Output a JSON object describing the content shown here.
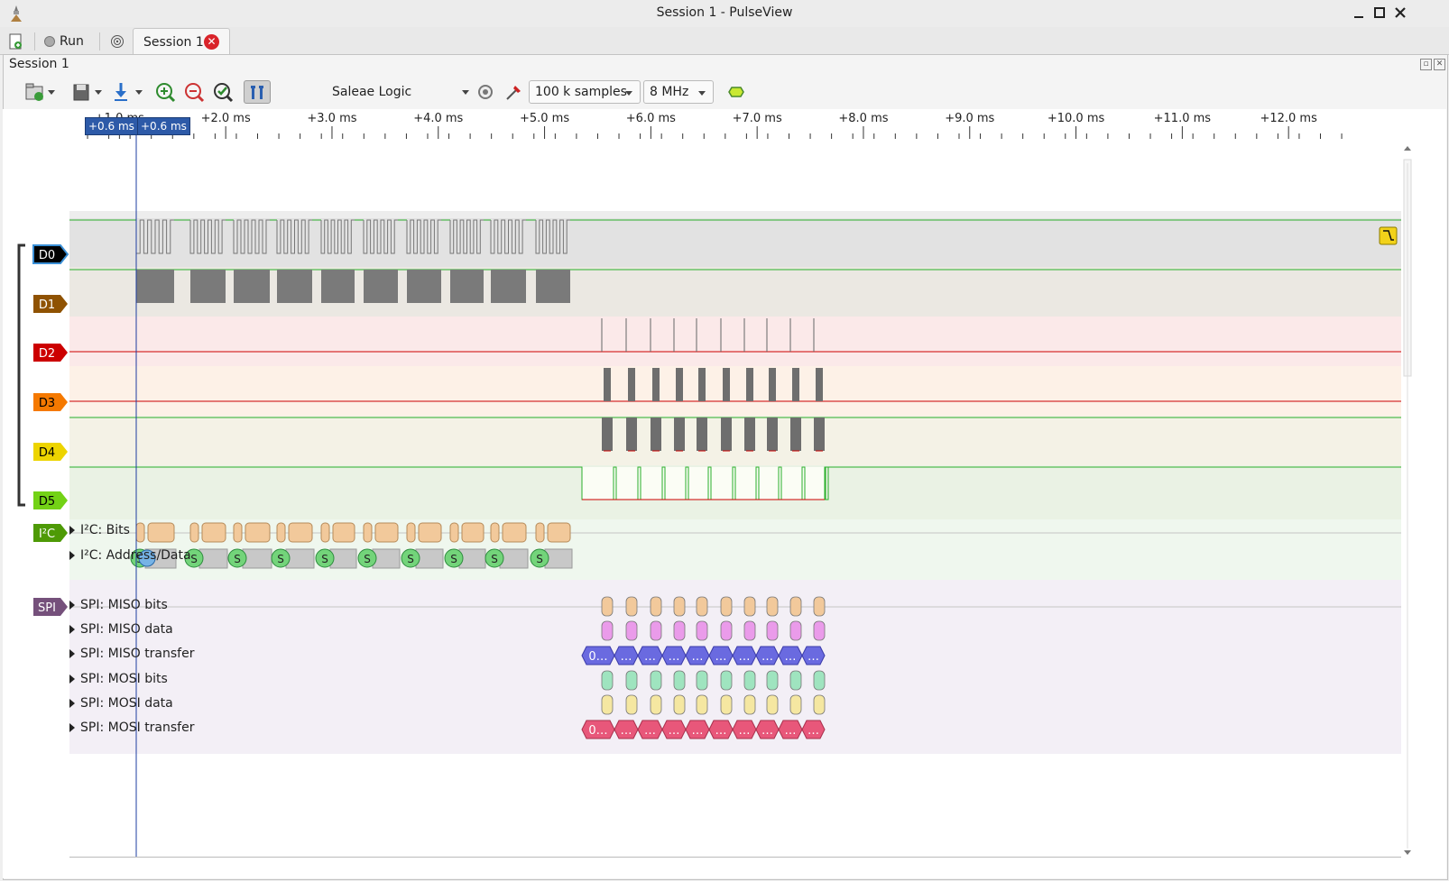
{
  "window": {
    "title": "Session 1 - PulseView"
  },
  "tabbar": {
    "run_label": "Run",
    "session_tab_label": "Session 1"
  },
  "panel": {
    "title": "Session 1"
  },
  "toolbar": {
    "device": "Saleae Logic",
    "samples": "100 k samples",
    "samplerate": "8 MHz"
  },
  "ruler": {
    "cursor_left": "+0.6 ms",
    "cursor_right": "+0.6 ms",
    "ticks": [
      "+1.0 ms",
      "+2.0 ms",
      "+3.0 ms",
      "+4.0 ms",
      "+5.0 ms",
      "+6.0 ms",
      "+7.0 ms",
      "+8.0 ms",
      "+9.0 ms",
      "+10.0 ms",
      "+11.0 ms",
      "+12.0 ms"
    ]
  },
  "channels": [
    {
      "name": "D0",
      "color": "#000000",
      "text_color": "#ffffff",
      "selected": true
    },
    {
      "name": "D1",
      "color": "#8f5202",
      "text_color": "#ffffff"
    },
    {
      "name": "D2",
      "color": "#cc0000",
      "text_color": "#ffffff"
    },
    {
      "name": "D3",
      "color": "#f57900",
      "text_color": "#000000"
    },
    {
      "name": "D4",
      "color": "#edd400",
      "text_color": "#000000"
    },
    {
      "name": "D5",
      "color": "#73d216",
      "text_color": "#000000"
    }
  ],
  "decoders": {
    "i2c": {
      "tag": "I²C",
      "color": "#4e9a06",
      "rows": [
        "I²C: Bits",
        "I²C: Address/Data"
      ]
    },
    "spi": {
      "tag": "SPI",
      "color": "#75507b",
      "rows": [
        "SPI: MISO bits",
        "SPI: MISO data",
        "SPI: MISO transfer",
        "SPI: MOSI bits",
        "SPI: MOSI data",
        "SPI: MOSI transfer"
      ]
    }
  },
  "annotations": {
    "i2c_start": "S",
    "spi_transfer_first": "0…",
    "spi_transfer_more": "…"
  },
  "colors": {
    "signal_high": "#2aaf2a",
    "signal_low": "#cc0000",
    "cursor": "#1d3ca0",
    "i2c_bits": "#f2c99b",
    "i2c_start": "#73d47a",
    "miso_bits": "#f2c99b",
    "miso_data": "#ea9bea",
    "miso_transfer": "#6a6ae0",
    "mosi_bits": "#9fe4bf",
    "mosi_data": "#f5e7a1",
    "mosi_transfer": "#e8577a"
  }
}
